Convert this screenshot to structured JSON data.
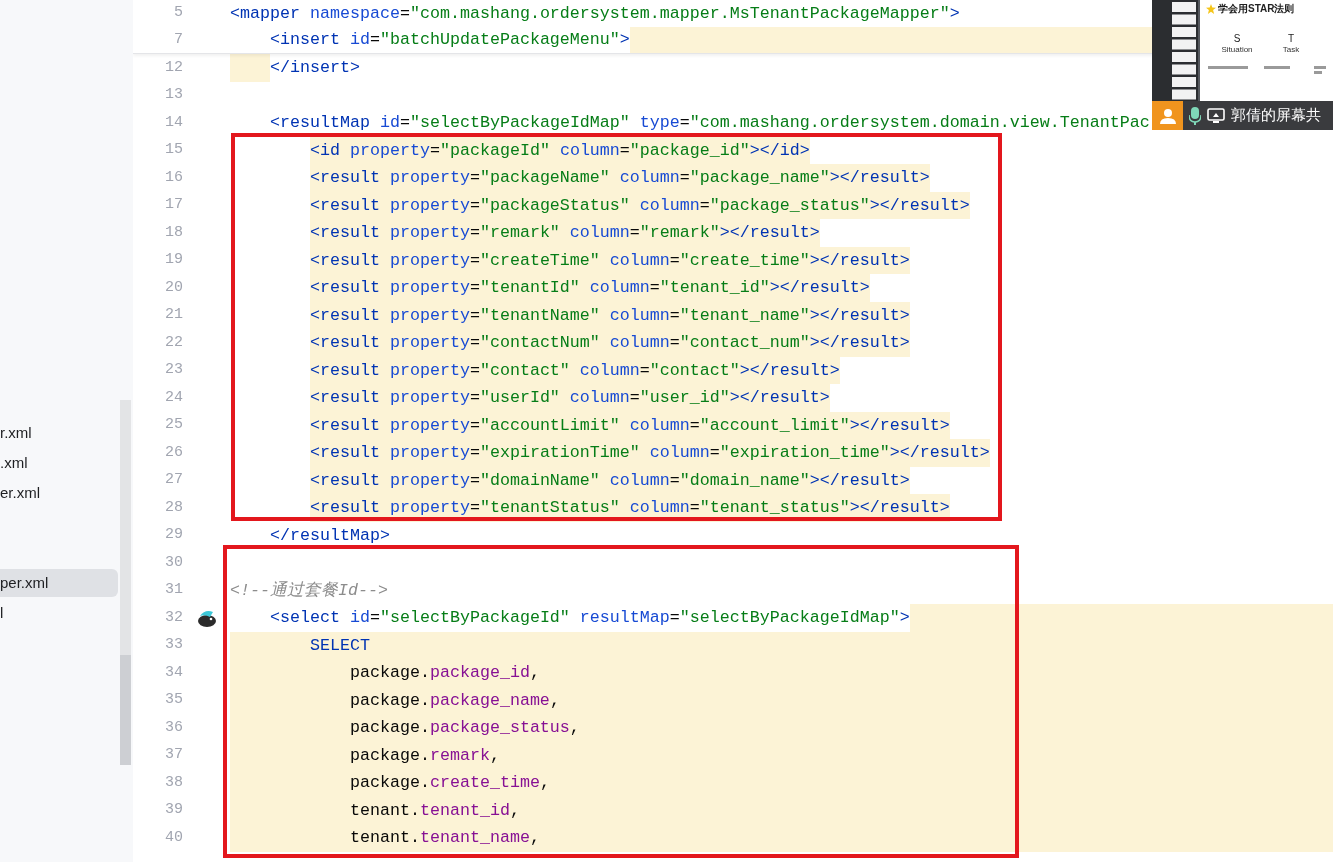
{
  "project_tree": {
    "items": [
      {
        "label": "r.xml",
        "selected": false
      },
      {
        "label": ".xml",
        "selected": false
      },
      {
        "label": "er.xml",
        "selected": false
      },
      {
        "label": "per.xml",
        "selected": true
      },
      {
        "label": "l",
        "selected": false
      }
    ]
  },
  "editor": {
    "sticky_lines": [
      {
        "number": "5",
        "kind": "plain",
        "tokens": [
          {
            "kind": "tag",
            "text": "<mapper"
          },
          {
            "kind": "attr",
            "text": " namespace"
          },
          {
            "kind": "punct",
            "text": "="
          },
          {
            "kind": "value",
            "text": "\"com.mashang.ordersystem.mapper.MsTenantPackageMapper\""
          },
          {
            "kind": "tag",
            "text": ">"
          }
        ]
      },
      {
        "number": "7",
        "kind": "after",
        "tokens": [
          {
            "kind": "tag",
            "text": "    <insert"
          },
          {
            "kind": "attr",
            "text": " id"
          },
          {
            "kind": "punct",
            "text": "="
          },
          {
            "kind": "value",
            "text": "\"batchUpdatePackageMenu\""
          },
          {
            "kind": "tag",
            "text": ">"
          }
        ]
      }
    ],
    "blocks": [
      {
        "lines": [
          {
            "number": "12",
            "kind": "indent",
            "tokens": [
              {
                "kind": "tag",
                "text": "    </insert>"
              }
            ]
          },
          {
            "number": "13",
            "kind": "plain"
          },
          {
            "number": "14",
            "kind": "plain",
            "tokens": [
              {
                "kind": "tag",
                "text": "    <resultMap"
              },
              {
                "kind": "attr",
                "text": " id"
              },
              {
                "kind": "punct",
                "text": "="
              },
              {
                "kind": "value",
                "text": "\"selectByPackageIdMap\""
              },
              {
                "kind": "attr",
                "text": " type"
              },
              {
                "kind": "punct",
                "text": "="
              },
              {
                "kind": "value",
                "text": "\"com.mashang.ordersystem.domain.view.TenantPac"
              }
            ]
          }
        ]
      },
      {
        "annotated": true,
        "lines": [
          {
            "number": "15",
            "kind": "code",
            "tokens": [
              {
                "kind": "tag",
                "text": "        <id"
              },
              {
                "kind": "attr",
                "text": " property"
              },
              {
                "kind": "punct",
                "text": "="
              },
              {
                "kind": "value",
                "text": "\"packageId\""
              },
              {
                "kind": "attr",
                "text": " column"
              },
              {
                "kind": "punct",
                "text": "="
              },
              {
                "kind": "value",
                "text": "\"package_id\""
              },
              {
                "kind": "tag",
                "text": "></id>"
              }
            ]
          },
          {
            "number": "16",
            "kind": "code",
            "tokens": [
              {
                "kind": "tag",
                "text": "        <result"
              },
              {
                "kind": "attr",
                "text": " property"
              },
              {
                "kind": "punct",
                "text": "="
              },
              {
                "kind": "value",
                "text": "\"packageName\""
              },
              {
                "kind": "attr",
                "text": " column"
              },
              {
                "kind": "punct",
                "text": "="
              },
              {
                "kind": "value",
                "text": "\"package_name\""
              },
              {
                "kind": "tag",
                "text": "></result>"
              }
            ]
          },
          {
            "number": "17",
            "kind": "code",
            "tokens": [
              {
                "kind": "tag",
                "text": "        <result"
              },
              {
                "kind": "attr",
                "text": " property"
              },
              {
                "kind": "punct",
                "text": "="
              },
              {
                "kind": "value",
                "text": "\"packageStatus\""
              },
              {
                "kind": "attr",
                "text": " column"
              },
              {
                "kind": "punct",
                "text": "="
              },
              {
                "kind": "value",
                "text": "\"package_status\""
              },
              {
                "kind": "tag",
                "text": "></result>"
              }
            ]
          },
          {
            "number": "18",
            "kind": "code",
            "tokens": [
              {
                "kind": "tag",
                "text": "        <result"
              },
              {
                "kind": "attr",
                "text": " property"
              },
              {
                "kind": "punct",
                "text": "="
              },
              {
                "kind": "value",
                "text": "\"remark\""
              },
              {
                "kind": "attr",
                "text": " column"
              },
              {
                "kind": "punct",
                "text": "="
              },
              {
                "kind": "value",
                "text": "\"remark\""
              },
              {
                "kind": "tag",
                "text": "></result>"
              }
            ]
          },
          {
            "number": "19",
            "kind": "code",
            "tokens": [
              {
                "kind": "tag",
                "text": "        <result"
              },
              {
                "kind": "attr",
                "text": " property"
              },
              {
                "kind": "punct",
                "text": "="
              },
              {
                "kind": "value",
                "text": "\"createTime\""
              },
              {
                "kind": "attr",
                "text": " column"
              },
              {
                "kind": "punct",
                "text": "="
              },
              {
                "kind": "value",
                "text": "\"create_time\""
              },
              {
                "kind": "tag",
                "text": "></result>"
              }
            ]
          },
          {
            "number": "20",
            "kind": "code",
            "tokens": [
              {
                "kind": "tag",
                "text": "        <result"
              },
              {
                "kind": "attr",
                "text": " property"
              },
              {
                "kind": "punct",
                "text": "="
              },
              {
                "kind": "value",
                "text": "\"tenantId\""
              },
              {
                "kind": "attr",
                "text": " column"
              },
              {
                "kind": "punct",
                "text": "="
              },
              {
                "kind": "value",
                "text": "\"tenant_id\""
              },
              {
                "kind": "tag",
                "text": "></result>"
              }
            ]
          },
          {
            "number": "21",
            "kind": "code",
            "tokens": [
              {
                "kind": "tag",
                "text": "        <result"
              },
              {
                "kind": "attr",
                "text": " property"
              },
              {
                "kind": "punct",
                "text": "="
              },
              {
                "kind": "value",
                "text": "\"tenantName\""
              },
              {
                "kind": "attr",
                "text": " column"
              },
              {
                "kind": "punct",
                "text": "="
              },
              {
                "kind": "value",
                "text": "\"tenant_name\""
              },
              {
                "kind": "tag",
                "text": "></result>"
              }
            ]
          },
          {
            "number": "22",
            "kind": "code",
            "tokens": [
              {
                "kind": "tag",
                "text": "        <result"
              },
              {
                "kind": "attr",
                "text": " property"
              },
              {
                "kind": "punct",
                "text": "="
              },
              {
                "kind": "value",
                "text": "\"contactNum\""
              },
              {
                "kind": "attr",
                "text": " column"
              },
              {
                "kind": "punct",
                "text": "="
              },
              {
                "kind": "value",
                "text": "\"contact_num\""
              },
              {
                "kind": "tag",
                "text": "></result>"
              }
            ]
          },
          {
            "number": "23",
            "kind": "code",
            "tokens": [
              {
                "kind": "tag",
                "text": "        <result"
              },
              {
                "kind": "attr",
                "text": " property"
              },
              {
                "kind": "punct",
                "text": "="
              },
              {
                "kind": "value",
                "text": "\"contact\""
              },
              {
                "kind": "attr",
                "text": " column"
              },
              {
                "kind": "punct",
                "text": "="
              },
              {
                "kind": "value",
                "text": "\"contact\""
              },
              {
                "kind": "tag",
                "text": "></result>"
              }
            ]
          },
          {
            "number": "24",
            "kind": "code",
            "tokens": [
              {
                "kind": "tag",
                "text": "        <result"
              },
              {
                "kind": "attr",
                "text": " property"
              },
              {
                "kind": "punct",
                "text": "="
              },
              {
                "kind": "value",
                "text": "\"userId\""
              },
              {
                "kind": "attr",
                "text": " column"
              },
              {
                "kind": "punct",
                "text": "="
              },
              {
                "kind": "value",
                "text": "\"user_id\""
              },
              {
                "kind": "tag",
                "text": "></result>"
              }
            ]
          },
          {
            "number": "25",
            "kind": "code",
            "tokens": [
              {
                "kind": "tag",
                "text": "        <result"
              },
              {
                "kind": "attr",
                "text": " property"
              },
              {
                "kind": "punct",
                "text": "="
              },
              {
                "kind": "value",
                "text": "\"accountLimit\""
              },
              {
                "kind": "attr",
                "text": " column"
              },
              {
                "kind": "punct",
                "text": "="
              },
              {
                "kind": "value",
                "text": "\"account_limit\""
              },
              {
                "kind": "tag",
                "text": "></result>"
              }
            ]
          },
          {
            "number": "26",
            "kind": "code",
            "tokens": [
              {
                "kind": "tag",
                "text": "        <result"
              },
              {
                "kind": "attr",
                "text": " property"
              },
              {
                "kind": "punct",
                "text": "="
              },
              {
                "kind": "value",
                "text": "\"expirationTime\""
              },
              {
                "kind": "attr",
                "text": " column"
              },
              {
                "kind": "punct",
                "text": "="
              },
              {
                "kind": "value",
                "text": "\"expiration_time\""
              },
              {
                "kind": "tag",
                "text": "></result>"
              }
            ]
          },
          {
            "number": "27",
            "kind": "code",
            "tokens": [
              {
                "kind": "tag",
                "text": "        <result"
              },
              {
                "kind": "attr",
                "text": " property"
              },
              {
                "kind": "punct",
                "text": "="
              },
              {
                "kind": "value",
                "text": "\"domainName\""
              },
              {
                "kind": "attr",
                "text": " column"
              },
              {
                "kind": "punct",
                "text": "="
              },
              {
                "kind": "value",
                "text": "\"domain_name\""
              },
              {
                "kind": "tag",
                "text": "></result>"
              }
            ]
          },
          {
            "number": "28",
            "kind": "code",
            "tokens": [
              {
                "kind": "tag",
                "text": "        <result"
              },
              {
                "kind": "attr",
                "text": " property"
              },
              {
                "kind": "punct",
                "text": "="
              },
              {
                "kind": "value",
                "text": "\"tenantStatus\""
              },
              {
                "kind": "attr",
                "text": " column"
              },
              {
                "kind": "punct",
                "text": "="
              },
              {
                "kind": "value",
                "text": "\"tenant_status\""
              },
              {
                "kind": "tag",
                "text": "></result>"
              }
            ]
          }
        ]
      },
      {
        "lines": [
          {
            "number": "29",
            "kind": "plain",
            "tokens": [
              {
                "kind": "tag",
                "text": "    </resultMap>"
              }
            ]
          }
        ]
      },
      {
        "annotated": true,
        "lines": [
          {
            "number": "30",
            "kind": "plain"
          },
          {
            "number": "31",
            "kind": "plain",
            "tokens": [
              {
                "kind": "comment",
                "text": "<!--通过套餐Id-->"
              }
            ]
          },
          {
            "number": "32",
            "kind": "after",
            "marker": true,
            "tokens": [
              {
                "kind": "tag",
                "text": "    <select"
              },
              {
                "kind": "attr",
                "text": " id"
              },
              {
                "kind": "punct",
                "text": "="
              },
              {
                "kind": "value",
                "text": "\"selectByPackageId\""
              },
              {
                "kind": "attr",
                "text": " resultMap"
              },
              {
                "kind": "punct",
                "text": "="
              },
              {
                "kind": "value",
                "text": "\"selectByPackageIdMap\""
              },
              {
                "kind": "tag",
                "text": ">"
              }
            ]
          },
          {
            "number": "33",
            "kind": "full",
            "tokens": [
              {
                "kind": "keyword",
                "text": "        SELECT"
              }
            ]
          },
          {
            "number": "34",
            "kind": "full",
            "tokens": [
              {
                "kind": "text",
                "text": "            package."
              },
              {
                "kind": "column",
                "text": "package_id"
              },
              {
                "kind": "text",
                "text": ","
              }
            ]
          },
          {
            "number": "35",
            "kind": "full",
            "tokens": [
              {
                "kind": "text",
                "text": "            package."
              },
              {
                "kind": "column",
                "text": "package_name"
              },
              {
                "kind": "text",
                "text": ","
              }
            ]
          },
          {
            "number": "36",
            "kind": "full",
            "tokens": [
              {
                "kind": "text",
                "text": "            package."
              },
              {
                "kind": "column",
                "text": "package_status"
              },
              {
                "kind": "text",
                "text": ","
              }
            ]
          },
          {
            "number": "37",
            "kind": "full",
            "tokens": [
              {
                "kind": "text",
                "text": "            package."
              },
              {
                "kind": "column",
                "text": "remark"
              },
              {
                "kind": "text",
                "text": ","
              }
            ]
          },
          {
            "number": "38",
            "kind": "full",
            "tokens": [
              {
                "kind": "text",
                "text": "            package."
              },
              {
                "kind": "column",
                "text": "create_time"
              },
              {
                "kind": "text",
                "text": ","
              }
            ]
          },
          {
            "number": "39",
            "kind": "full",
            "tokens": [
              {
                "kind": "text",
                "text": "            tenant."
              },
              {
                "kind": "column",
                "text": "tenant_id"
              },
              {
                "kind": "text",
                "text": ","
              }
            ]
          },
          {
            "number": "40",
            "kind": "full",
            "tokens": [
              {
                "kind": "text",
                "text": "            tenant."
              },
              {
                "kind": "column",
                "text": "tenant_name"
              },
              {
                "kind": "text",
                "text": ","
              }
            ]
          }
        ]
      }
    ]
  },
  "screen_share": {
    "slide_title": "学会用STAR法则",
    "columns": [
      {
        "letter": "S",
        "word": "Situation"
      },
      {
        "letter": "T",
        "word": "Task"
      }
    ],
    "presenter_label": "郭倩的屏幕共"
  }
}
